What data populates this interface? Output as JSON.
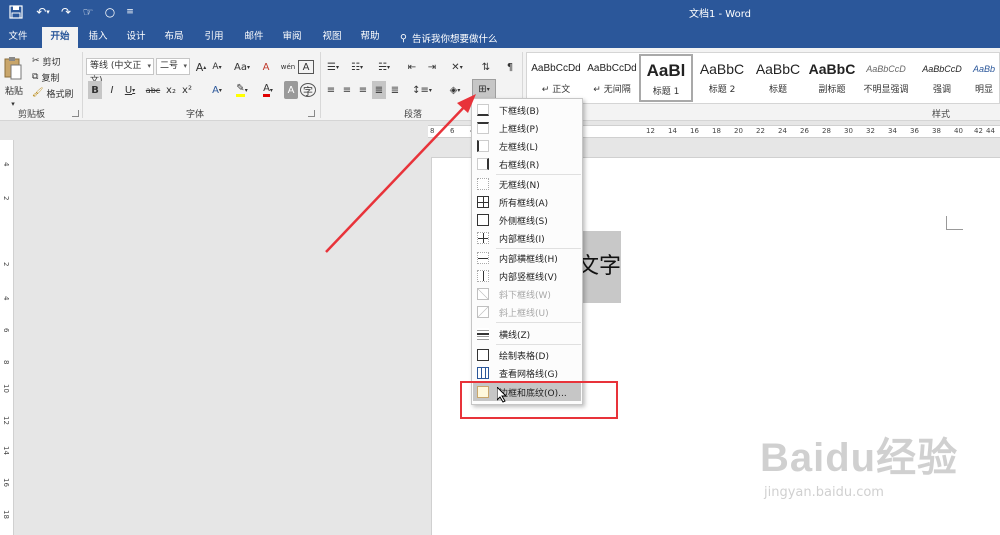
{
  "window": {
    "title": "文档1 - Word"
  },
  "tabs": [
    "文件",
    "开始",
    "插入",
    "设计",
    "布局",
    "引用",
    "邮件",
    "审阅",
    "视图",
    "帮助"
  ],
  "tell_me": "告诉我你想要做什么",
  "clipboard": {
    "paste": "粘贴",
    "cut": "剪切",
    "copy": "复制",
    "format_painter": "格式刷",
    "label": "剪贴板"
  },
  "font": {
    "name": "等线 (中文正文)",
    "size": "二号",
    "label": "字体",
    "bold": "B",
    "italic": "I",
    "underline": "U",
    "strike": "abc",
    "subscript": "x₂",
    "superscript": "x²",
    "change_case": "Aa",
    "clear": "A",
    "grow": "A",
    "shrink": "A",
    "phonetic": "wén",
    "char_border": "A"
  },
  "paragraph": {
    "label": "段落"
  },
  "styles": {
    "label": "样式",
    "items": [
      {
        "sample": "AaBbCcDd",
        "name": "↵ 正文"
      },
      {
        "sample": "AaBbCcDd",
        "name": "↵ 无间隔"
      },
      {
        "sample": "AaBl",
        "name": "标题 1"
      },
      {
        "sample": "AaBbC",
        "name": "标题 2"
      },
      {
        "sample": "AaBbC",
        "name": "标题"
      },
      {
        "sample": "AaBbC",
        "name": "副标题"
      },
      {
        "sample": "AaBbCcD",
        "name": "不明显强调"
      },
      {
        "sample": "AaBbCcD",
        "name": "强调"
      },
      {
        "sample": "AaBb",
        "name": "明显"
      }
    ]
  },
  "ruler": {
    "h_ticks": [
      "8",
      "6",
      "4",
      "12",
      "14",
      "16",
      "18",
      "20",
      "22",
      "24",
      "26",
      "28",
      "30",
      "32",
      "34",
      "36",
      "38",
      "40",
      "42",
      "44"
    ],
    "v_ticks": [
      "4",
      "2",
      "2",
      "4",
      "6",
      "8",
      "10",
      "12",
      "14",
      "16",
      "18"
    ]
  },
  "document": {
    "textbox_text": "文字"
  },
  "border_menu": {
    "items": [
      {
        "label": "下框线(B)",
        "disabled": false
      },
      {
        "label": "上框线(P)",
        "disabled": false
      },
      {
        "label": "左框线(L)",
        "disabled": false
      },
      {
        "label": "右框线(R)",
        "disabled": false
      },
      {
        "label": "无框线(N)",
        "disabled": false
      },
      {
        "label": "所有框线(A)",
        "disabled": false
      },
      {
        "label": "外侧框线(S)",
        "disabled": false
      },
      {
        "label": "内部框线(I)",
        "disabled": false
      },
      {
        "label": "内部横框线(H)",
        "disabled": false
      },
      {
        "label": "内部竖框线(V)",
        "disabled": false
      },
      {
        "label": "斜下框线(W)",
        "disabled": true
      },
      {
        "label": "斜上框线(U)",
        "disabled": true
      },
      {
        "label": "横线(Z)",
        "disabled": false
      },
      {
        "label": "绘制表格(D)",
        "disabled": false
      },
      {
        "label": "查看网格线(G)",
        "disabled": false
      },
      {
        "label": "边框和底纹(O)...",
        "disabled": false
      }
    ]
  },
  "watermark": {
    "brand": "Baidu经验",
    "url": "jingyan.baidu.com"
  },
  "colors": {
    "ribbon_blue": "#2b579a",
    "annotation_red": "#e8333a"
  }
}
